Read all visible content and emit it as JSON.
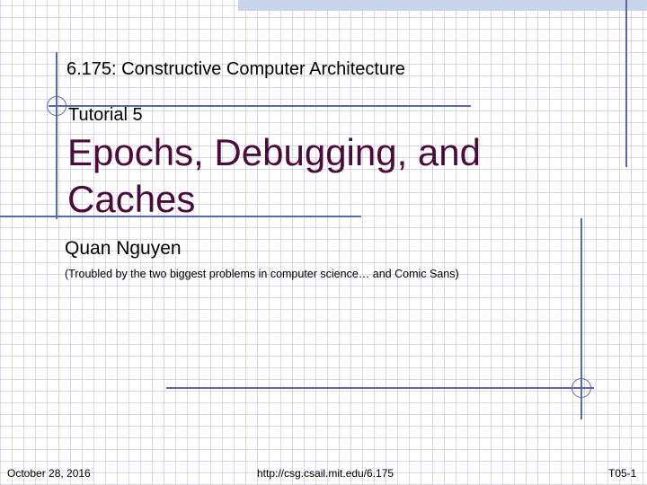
{
  "slide": {
    "course_title": "6.175: Constructive Computer Architecture",
    "tutorial_label": "Tutorial 5",
    "title": "Epochs, Debugging, and Caches",
    "author": "Quan Nguyen",
    "author_note": "(Troubled by the two biggest problems in computer science… and Comic Sans)"
  },
  "footer": {
    "date": "October 28, 2016",
    "url": "http://csg.csail.mit.edu/6.175",
    "slide_number": "T05-1"
  },
  "colors": {
    "title": "#4a0a3a",
    "decoration": "#5a6aa8",
    "band": "#c8d3ec"
  }
}
